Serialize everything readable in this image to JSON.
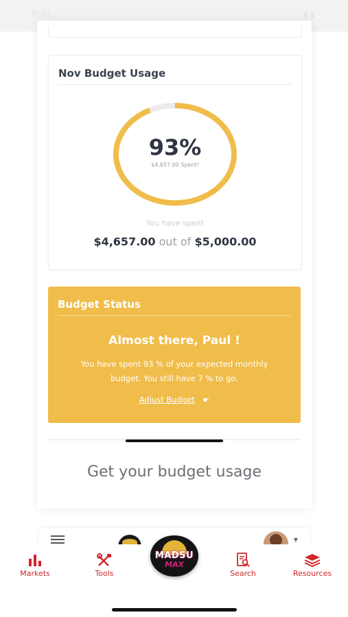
{
  "status_bar": {
    "time": "9:41",
    "icons": "▮ ▮"
  },
  "usage_card": {
    "title": "Nov Budget Usage",
    "percent": "93%",
    "percent_value": 0.93,
    "spent_note": "$4,657.00 Spent!",
    "spent_label": "You have spent",
    "spent_amount": "$4,657.00",
    "out_of": "out of",
    "budget_amount": "$5,000.00",
    "ring_color": "#f0bd4b",
    "ring_track_color": "#ebebeb"
  },
  "status_card": {
    "title": "Budget Status",
    "headline": "Almost there, Paul !",
    "body": "You have spent 93 % of your expected monthly budget. You still have 7 % to go.",
    "adjust_link": "Adjust Budget",
    "adjust_icon": "☛",
    "color": "#f0bd4b"
  },
  "get_usage_text": "Get your budget usage",
  "tabs": [
    {
      "label": "Markets",
      "icon": "bar-chart-icon"
    },
    {
      "label": "Tools",
      "icon": "tools-icon"
    },
    {
      "label": "Search",
      "icon": "document-search-icon"
    },
    {
      "label": "Resources",
      "icon": "layers-icon"
    }
  ],
  "center_brand": {
    "line1": "MADSU",
    "line2": "MAX"
  },
  "accent_color": "#d0262b"
}
